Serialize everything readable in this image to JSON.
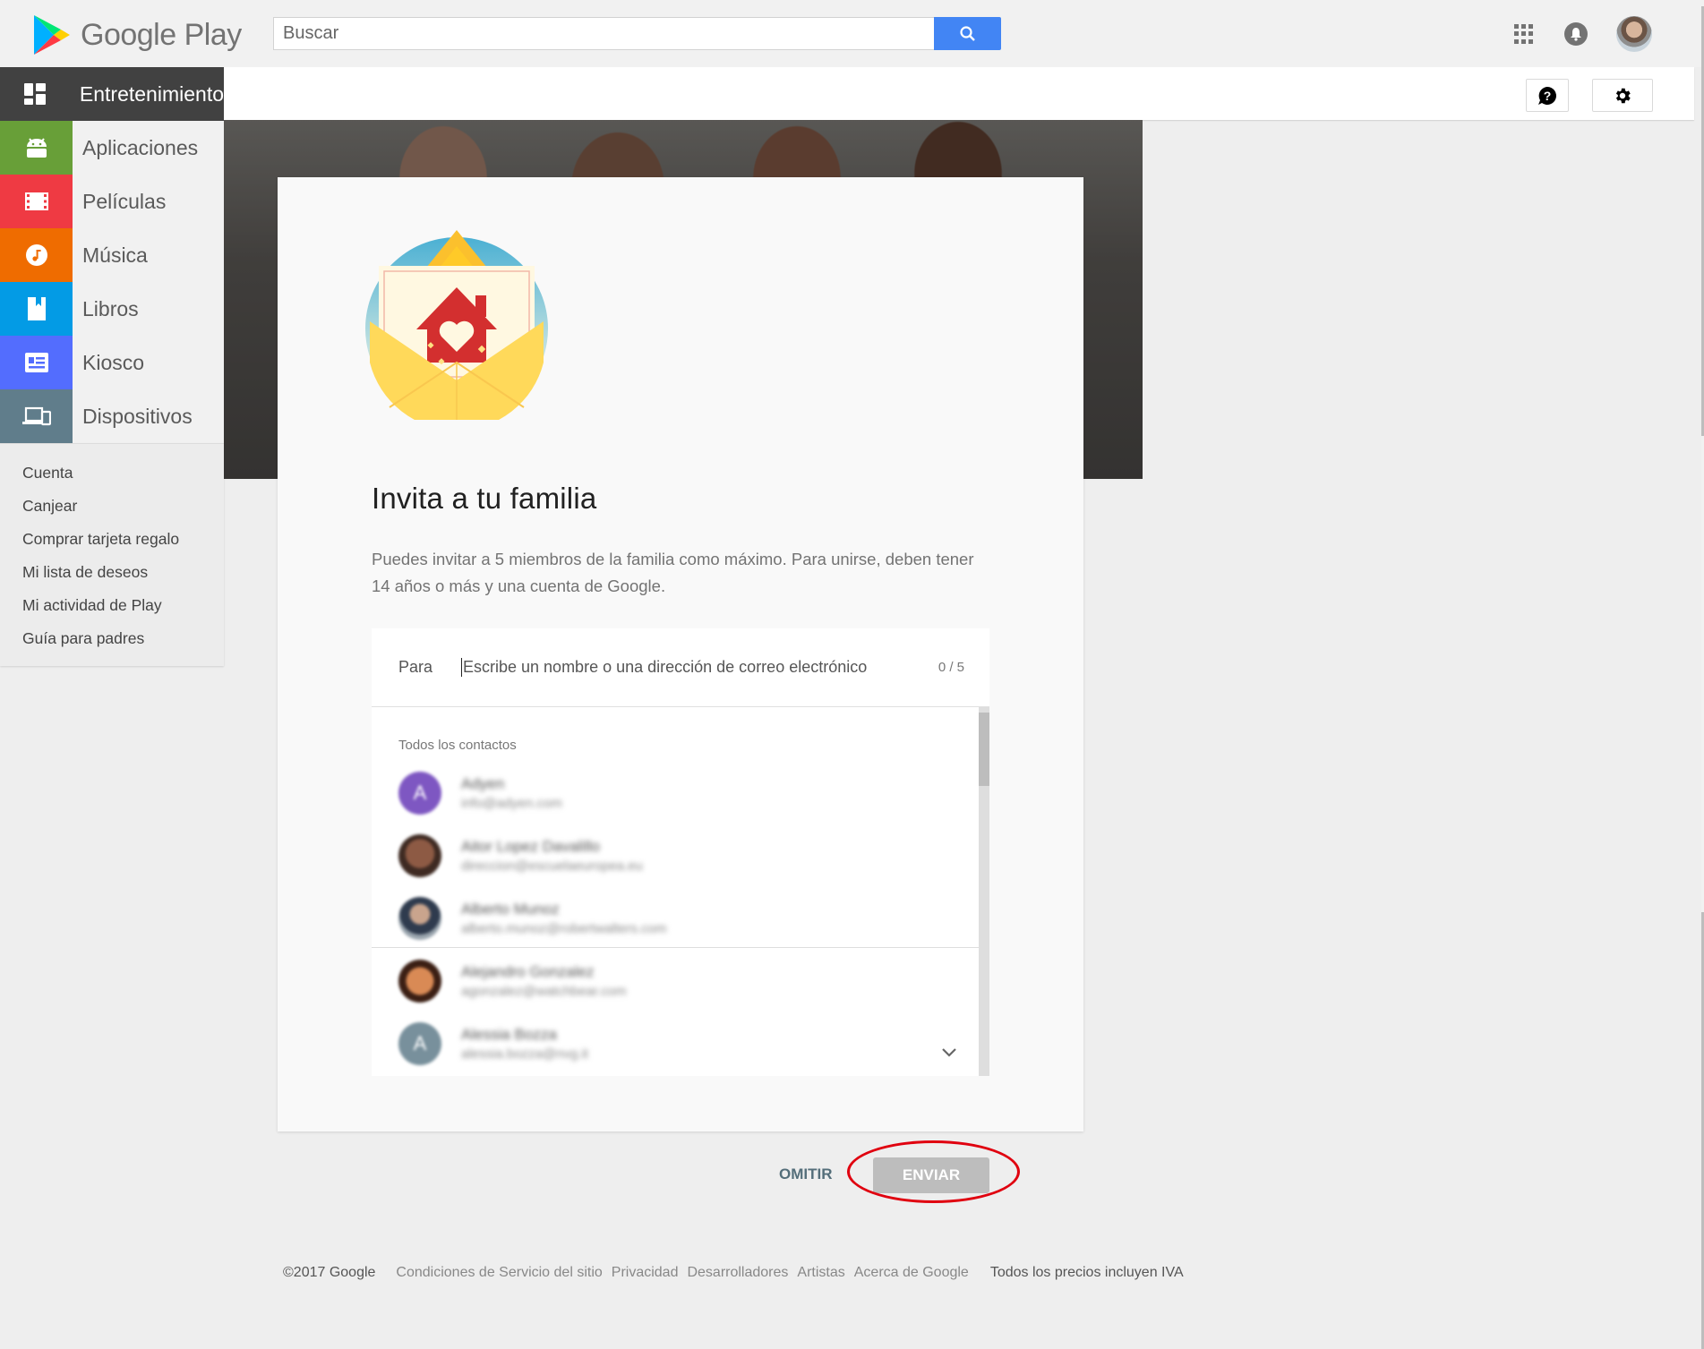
{
  "app": {
    "name": "Google Play"
  },
  "search": {
    "placeholder": "Buscar"
  },
  "header_icons": [
    "apps-grid-icon",
    "notifications-icon",
    "account-avatar"
  ],
  "sidebar": {
    "items": [
      {
        "label": "Entretenimiento",
        "icon": "grid-icon",
        "color": "#414141",
        "active": true
      },
      {
        "label": "Aplicaciones",
        "icon": "android-icon",
        "color": "#689f38"
      },
      {
        "label": "Películas",
        "icon": "film-icon",
        "color": "#ef3a43"
      },
      {
        "label": "Música",
        "icon": "music-icon",
        "color": "#ef6c00"
      },
      {
        "label": "Libros",
        "icon": "book-icon",
        "color": "#039be5"
      },
      {
        "label": "Kiosco",
        "icon": "newsstand-icon",
        "color": "#536dfe"
      },
      {
        "label": "Dispositivos",
        "icon": "devices-icon",
        "color": "#607d8b"
      }
    ],
    "links": [
      "Cuenta",
      "Canjear",
      "Comprar tarjeta regalo",
      "Mi lista de deseos",
      "Mi actividad de Play",
      "Guía para padres"
    ]
  },
  "dialog": {
    "title": "Invita a tu familia",
    "description": "Puedes invitar a 5 miembros de la familia como máximo. Para unirse, deben tener 14 años o más y una cuenta de Google.",
    "to_label": "Para",
    "to_placeholder": "Escribe un nombre o una dirección de correo electrónico",
    "count": "0 / 5",
    "contacts_heading": "Todos los contactos",
    "contacts": [
      {
        "name": "Adyen",
        "email": "info@adyen.com",
        "initial": "A",
        "avatar_color": "#7e57c2"
      },
      {
        "name": "Aitor Lopez Davalillo",
        "email": "direccion@escuelaeuropea.eu",
        "initial": "",
        "avatar_color": "#6d4c41"
      },
      {
        "name": "Alberto Munoz",
        "email": "alberto.munoz@robertwalters.com",
        "initial": "",
        "avatar_color": "#5d6b7a"
      },
      {
        "name": "Alejandro Gonzalez",
        "email": "agonzalez@watchbear.com",
        "initial": "",
        "avatar_color": "#b5653a"
      },
      {
        "name": "Alessia Bozza",
        "email": "alessia.bozza@nvg.it",
        "initial": "A",
        "avatar_color": "#78909c"
      }
    ],
    "skip_label": "OMITIR",
    "send_label": "ENVIAR"
  },
  "footer": {
    "copyright": "©2017 Google",
    "links": [
      "Condiciones de Servicio del sitio",
      "Privacidad",
      "Desarrolladores",
      "Artistas",
      "Acerca de Google"
    ],
    "note": "Todos los precios incluyen IVA"
  },
  "annotation": {
    "highlight": "ENVIAR",
    "color": "#e0000f"
  }
}
